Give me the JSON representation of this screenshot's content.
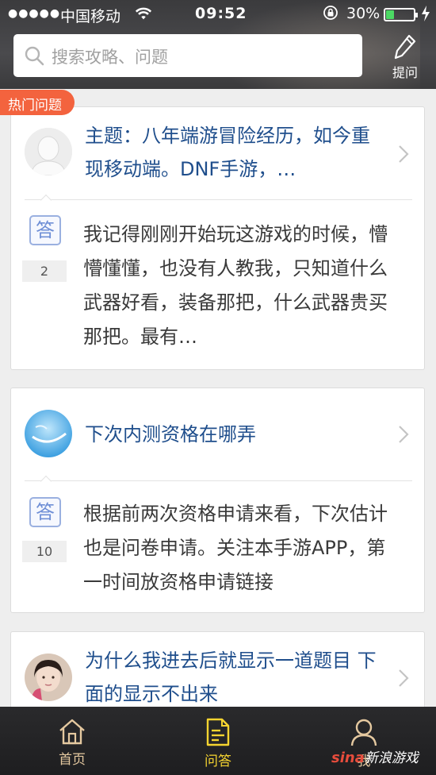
{
  "status_bar": {
    "signal": "●●●●●",
    "carrier": "中国移动",
    "time": "09:52",
    "battery_percent": "30%",
    "battery_level": 0.3
  },
  "search": {
    "placeholder": "搜索攻略、问题"
  },
  "ask_button": {
    "label": "提问"
  },
  "hot_badge": "热门问题",
  "questions": [
    {
      "title": "主题：八年端游冒险经历，如今重现移动端。DNF手游，…",
      "answer_count": "2",
      "answer_label": "答",
      "answer": "我记得刚刚开始玩这游戏的时候，懵懵懂懂，也没有人教我，只知道什么武器好看，装备那把，什么武器贵买那把。最有…"
    },
    {
      "title": "下次内测资格在哪弄",
      "answer_count": "10",
      "answer_label": "答",
      "answer": "根据前两次资格申请来看，下次估计也是问卷申请。关注本手游APP，第一时间放资格申请链接"
    },
    {
      "title": "为什么我进去后就显示一道题目 下面的显示不出来"
    }
  ],
  "tabs": [
    {
      "label": "首页",
      "icon": "home-icon",
      "active": false
    },
    {
      "label": "问答",
      "icon": "qa-document-icon",
      "active": true
    },
    {
      "label": "我",
      "icon": "user-icon",
      "active": false
    }
  ],
  "watermark": {
    "logo": "sina",
    "text": "新浪游戏"
  },
  "colors": {
    "accent": "#f3633e",
    "title_blue": "#1f4e8c",
    "active_tab": "#f5d430",
    "inactive_tab": "#e5c9a0"
  }
}
